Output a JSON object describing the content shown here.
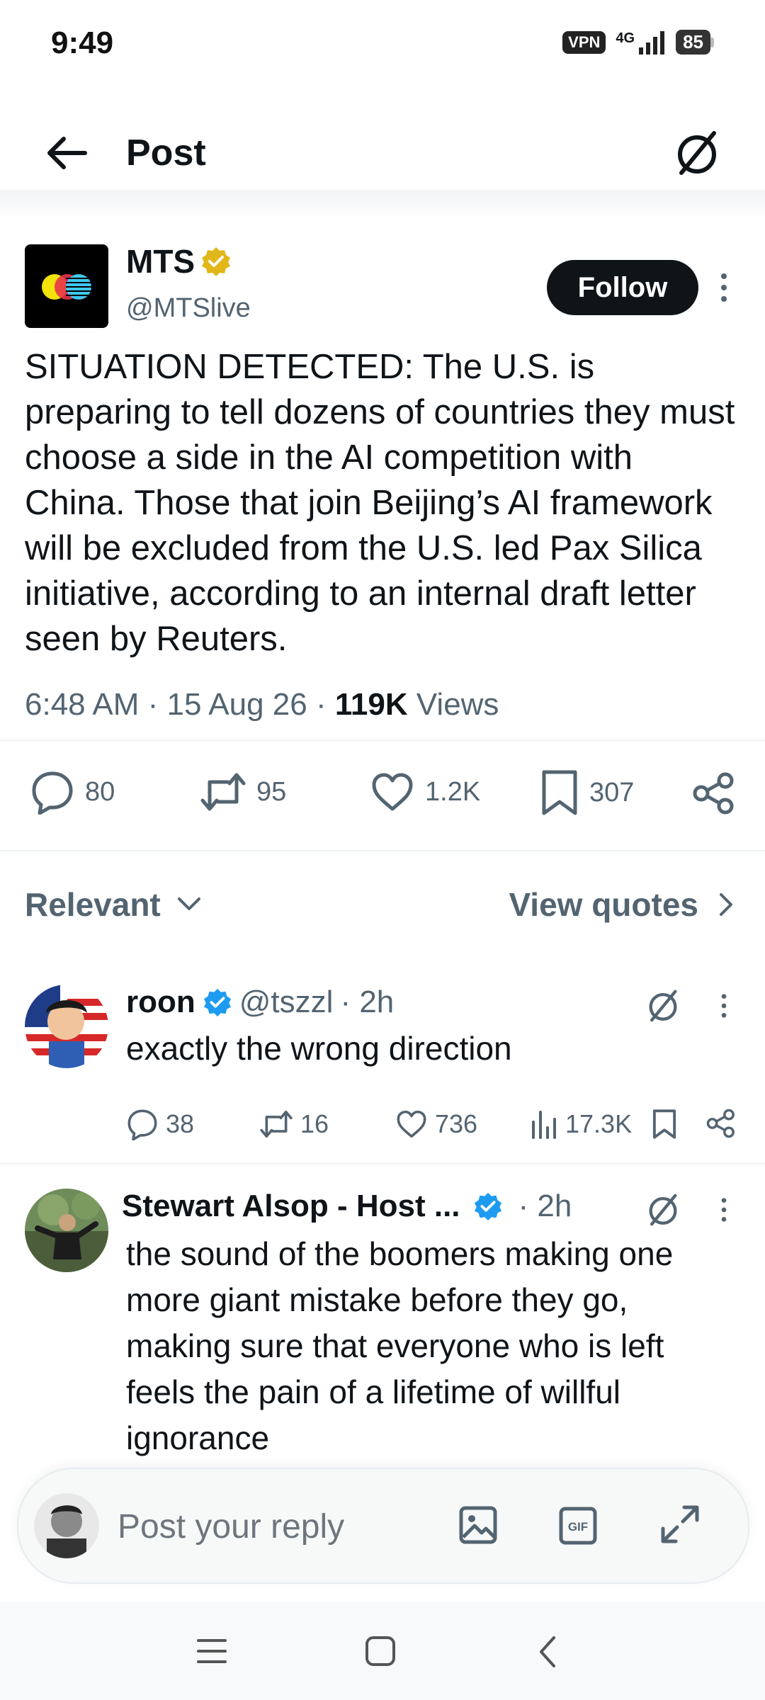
{
  "status_bar": {
    "time": "9:49",
    "vpn": "VPN",
    "network": "4G",
    "battery": "85"
  },
  "header": {
    "title": "Post",
    "back_icon": "arrow-left-icon",
    "grok_icon": "slash-circle-icon"
  },
  "post": {
    "author_name": "MTS",
    "author_handle": "@MTSlive",
    "follow_label": "Follow",
    "text": "SITUATION DETECTED: The U.S. is preparing to tell dozens of countries they must choose a side in the AI competition with China. Those that join Beijing’s AI framework will be excluded from the U.S. led Pax Silica initiative, according to an internal draft letter seen by Reuters.",
    "time": "6:48 AM",
    "date": "15 Aug 26",
    "views_count": "119K",
    "views_label": "Views",
    "actions": {
      "replies": "80",
      "reposts": "95",
      "likes": "1.2K",
      "bookmarks": "307"
    }
  },
  "replies_bar": {
    "sort_label": "Relevant",
    "quotes_label": "View quotes"
  },
  "replies": [
    {
      "name": "roon",
      "handle": "@tszzl",
      "time": "· 2h",
      "text": "exactly the wrong direction",
      "actions": {
        "replies": "38",
        "reposts": "16",
        "likes": "736",
        "views": "17.3K"
      }
    },
    {
      "name": "Stewart Alsop - Host ...",
      "time": "· 2h",
      "text": "the sound of the boomers making one more giant mistake before they go, making sure that everyone who is left feels the pain of a lifetime of willful ignorance"
    }
  ],
  "composer": {
    "placeholder": "Post your reply"
  },
  "colors": {
    "text": "#0f1419",
    "secondary": "#536471",
    "verified_blue": "#1d9bf0",
    "verified_gold": "#e2b719"
  }
}
